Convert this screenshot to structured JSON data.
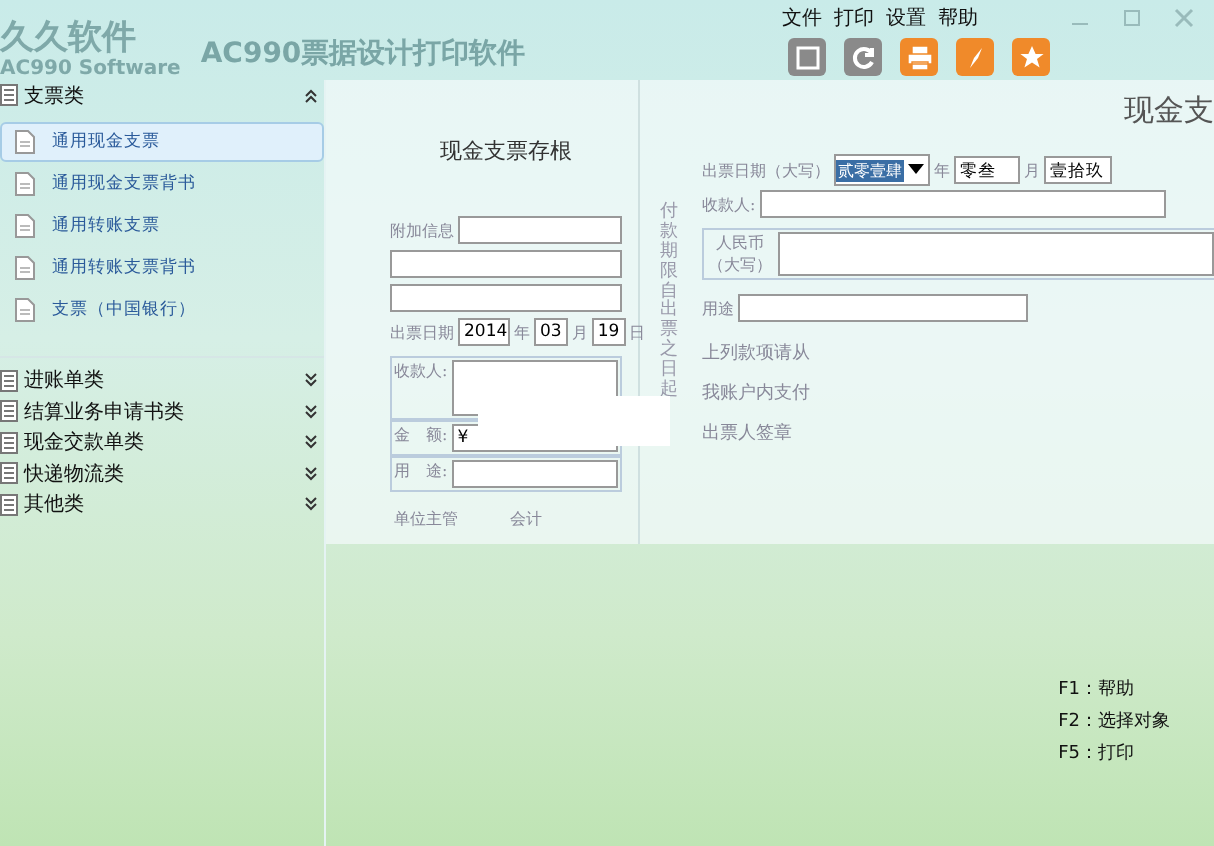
{
  "logo": {
    "name": "久久软件",
    "subtitle": "AC990 Software"
  },
  "app_title": "AC990票据设计打印软件",
  "menu": [
    "文件",
    "打印",
    "设置",
    "帮助"
  ],
  "sidebar": {
    "categories": [
      {
        "label": "支票类",
        "expanded": true,
        "items": [
          {
            "label": "通用现金支票",
            "selected": true
          },
          {
            "label": "通用现金支票背书",
            "selected": false
          },
          {
            "label": "通用转账支票",
            "selected": false
          },
          {
            "label": "通用转账支票背书",
            "selected": false
          },
          {
            "label": "支票（中国银行）",
            "selected": false
          }
        ]
      },
      {
        "label": "进账单类",
        "expanded": false
      },
      {
        "label": "结算业务申请书类",
        "expanded": false
      },
      {
        "label": "现金交款单类",
        "expanded": false
      },
      {
        "label": "快递物流类",
        "expanded": false
      },
      {
        "label": "其他类",
        "expanded": false
      }
    ]
  },
  "stub": {
    "title": "现金支票存根",
    "extra_label": "附加信息",
    "date_label": "出票日期",
    "year": "2014",
    "year_unit": "年",
    "month": "03",
    "month_unit": "月",
    "day": "19",
    "day_unit": "日",
    "payee_label": "收款人:",
    "amount_label": "金　额:",
    "currency": "¥",
    "purpose_label": "用　途:",
    "footer": [
      "单位主管",
      "会计"
    ]
  },
  "check": {
    "title": "现金支",
    "vertical_note": "付款期限自出票之日起",
    "date_label": "出票日期（大写）",
    "year_value": "贰零壹肆",
    "year_unit": "年",
    "month_value": "零叁",
    "month_unit": "月",
    "day_value": "壹拾玖",
    "payee_label": "收款人:",
    "rmb_label": "人民币（大写）",
    "purpose_label": "用途",
    "lines": [
      "上列款项请从",
      "我账户内支付",
      "出票人签章"
    ]
  },
  "shortcuts": [
    "F1：帮助",
    "F2：选择对象",
    "F5：打印"
  ]
}
